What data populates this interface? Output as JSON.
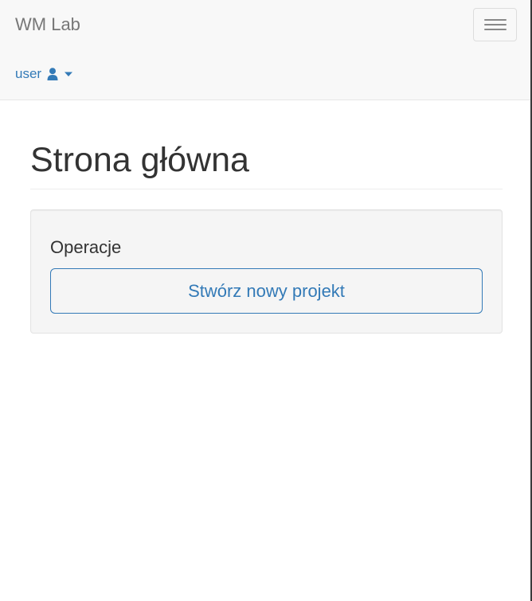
{
  "navbar": {
    "brand": "WM Lab",
    "toggle_icon": "hamburger-menu-icon",
    "user": {
      "label": "user",
      "icon": "user-icon",
      "caret_icon": "caret-down-icon",
      "color": "#337ab7"
    }
  },
  "main": {
    "title": "Strona główna",
    "panel": {
      "label": "Operacje",
      "button_label": "Stwórz nowy projekt"
    }
  },
  "colors": {
    "navbar_bg": "#f8f8f8",
    "accent": "#337ab7",
    "panel_bg": "#f5f5f5",
    "text": "#333333"
  }
}
